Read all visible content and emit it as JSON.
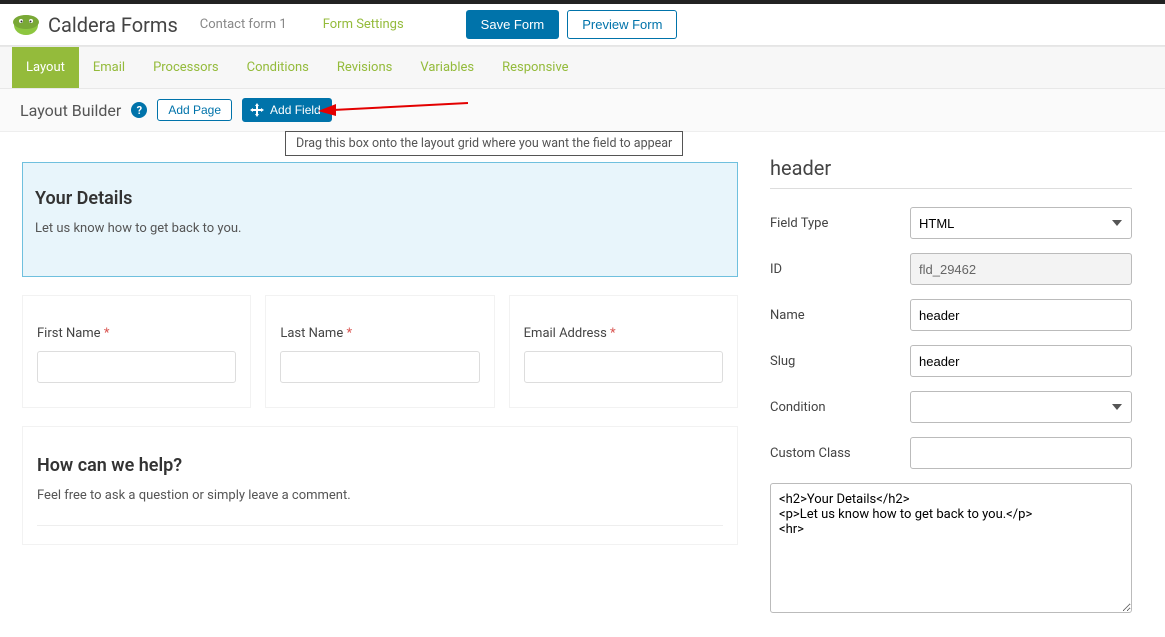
{
  "header": {
    "brand": "Caldera Forms",
    "form_tab": "Contact form 1",
    "settings_tab": "Form Settings",
    "save": "Save Form",
    "preview": "Preview Form"
  },
  "tabs": {
    "layout": "Layout",
    "email": "Email",
    "processors": "Processors",
    "conditions": "Conditions",
    "revisions": "Revisions",
    "variables": "Variables",
    "responsive": "Responsive"
  },
  "builder": {
    "title": "Layout Builder",
    "add_page": "Add Page",
    "add_field": "Add Field",
    "tooltip": "Drag this box onto the layout grid where you want the field to appear"
  },
  "preview": {
    "header_title": "Your Details",
    "header_desc": "Let us know how to get back to you.",
    "first_name": "First Name",
    "last_name": "Last Name",
    "email": "Email Address",
    "section2_title": "How can we help?",
    "section2_desc": "Feel free to ask a question or simply leave a comment."
  },
  "panel": {
    "title": "header",
    "labels": {
      "field_type": "Field Type",
      "id": "ID",
      "name": "Name",
      "slug": "Slug",
      "condition": "Condition",
      "custom_class": "Custom Class"
    },
    "values": {
      "field_type": "HTML",
      "id": "fld_29462",
      "name": "header",
      "slug": "header",
      "condition": "",
      "custom_class": "",
      "content": "<h2>Your Details</h2>\n<p>Let us know how to get back to you.</p>\n<hr>"
    }
  }
}
